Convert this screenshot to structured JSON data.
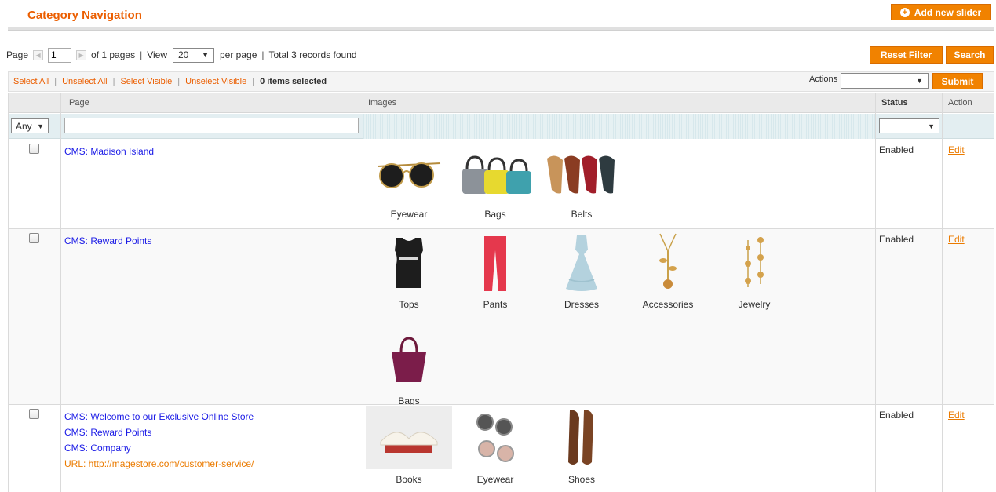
{
  "header": {
    "title": "Category Navigation",
    "add_button": "Add new slider"
  },
  "pager": {
    "page_label": "Page",
    "page_value": "1",
    "of_pages": "of 1 pages",
    "view_label": "View",
    "per_page_value": "20",
    "per_page_label": "per page",
    "records": "Total 3 records found",
    "separator": "|"
  },
  "buttons": {
    "reset": "Reset Filter",
    "search": "Search",
    "submit": "Submit"
  },
  "massaction": {
    "select_all": "Select All",
    "unselect_all": "Unselect All",
    "select_visible": "Select Visible",
    "unselect_visible": "Unselect Visible",
    "selected_count": "0 items selected",
    "actions_label": "Actions"
  },
  "columns": {
    "page": "Page",
    "images": "Images",
    "status": "Status",
    "action": "Action"
  },
  "filters": {
    "any": "Any"
  },
  "rows": [
    {
      "pages": [
        "CMS: Madison Island"
      ],
      "status": "Enabled",
      "edit": "Edit",
      "images": [
        "Eyewear",
        "Bags",
        "Belts"
      ]
    },
    {
      "pages": [
        "CMS: Reward Points"
      ],
      "status": "Enabled",
      "edit": "Edit",
      "images": [
        "Tops",
        "Pants",
        "Dresses",
        "Accessories",
        "Jewelry",
        "Bags"
      ]
    },
    {
      "pages": [
        "CMS: Welcome to our Exclusive Online Store",
        "CMS: Reward Points",
        "CMS: Company"
      ],
      "url": "URL: http://magestore.com/customer-service/",
      "status": "Enabled",
      "edit": "Edit",
      "images": [
        "Books",
        "Eyewear",
        "Shoes"
      ]
    }
  ],
  "icons": {
    "add": "plus-circle-icon",
    "prev": "arrow-left-icon",
    "next": "arrow-right-icon",
    "caret": "caret-down-icon"
  },
  "colors": {
    "accent": "#f18200",
    "title": "#eb5e00",
    "link": "#1a1ae6",
    "filter_bg": "#e3eef1"
  }
}
